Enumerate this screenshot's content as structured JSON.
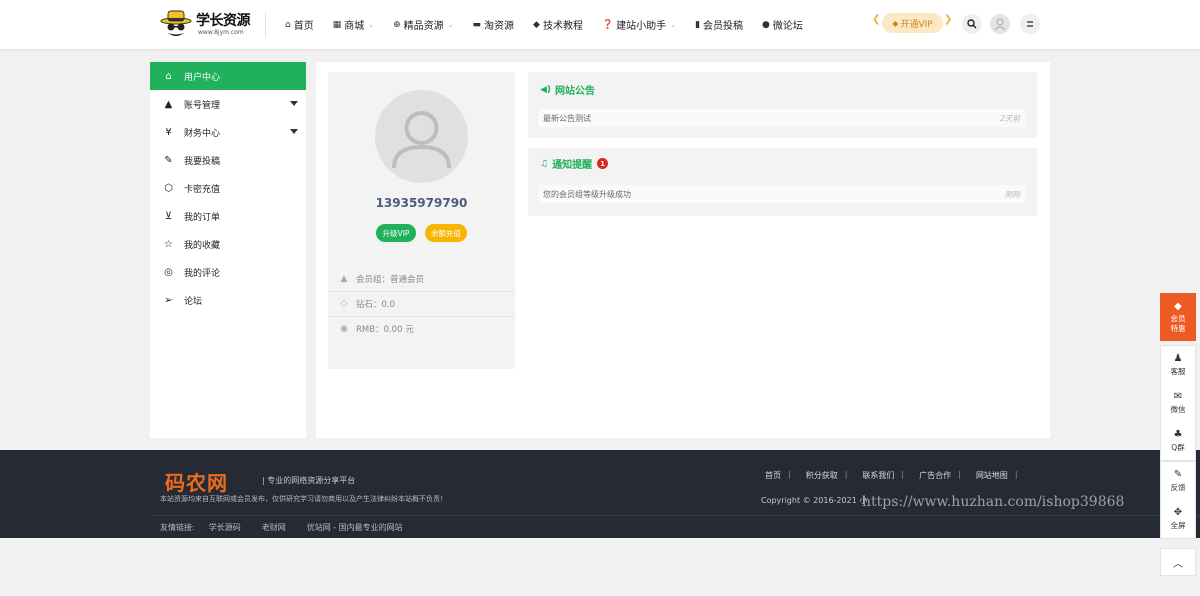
{
  "header": {
    "logo_text": "学长资源",
    "logo_sub": "www.8jym.com",
    "nav": [
      {
        "icon": "home-icon",
        "glyph": "⌂",
        "label": "首页",
        "caret": false
      },
      {
        "icon": "shop-icon",
        "glyph": "▦",
        "label": "商城",
        "caret": true
      },
      {
        "icon": "globe-icon",
        "glyph": "⊕",
        "label": "精品资源",
        "caret": true
      },
      {
        "icon": "briefcase-icon",
        "glyph": "▬",
        "label": "淘资源",
        "caret": false
      },
      {
        "icon": "graduation-icon",
        "glyph": "◆",
        "label": "技术教程",
        "caret": false
      },
      {
        "icon": "question-icon",
        "glyph": "❓",
        "label": "建站小助手",
        "caret": true
      },
      {
        "icon": "book-icon",
        "glyph": "▮",
        "label": "会员投稿",
        "caret": false
      },
      {
        "icon": "chat-icon",
        "glyph": "●",
        "label": "微论坛",
        "caret": false
      }
    ],
    "vip_label": "开通VIP"
  },
  "sidebar": {
    "items": [
      {
        "icon": "home-icon",
        "glyph": "⌂",
        "label": "用户中心",
        "active": true,
        "caret": false
      },
      {
        "icon": "user-icon",
        "glyph": "▲",
        "label": "账号管理",
        "active": false,
        "caret": true
      },
      {
        "icon": "yen-icon",
        "glyph": "¥",
        "label": "财务中心",
        "active": false,
        "caret": true
      },
      {
        "icon": "edit-icon",
        "glyph": "✎",
        "label": "我要投稿",
        "active": false,
        "caret": false
      },
      {
        "icon": "cube-icon",
        "glyph": "⬡",
        "label": "卡密充值",
        "active": false,
        "caret": false
      },
      {
        "icon": "cart-icon",
        "glyph": "⊻",
        "label": "我的订单",
        "active": false,
        "caret": false
      },
      {
        "icon": "star-icon",
        "glyph": "☆",
        "label": "我的收藏",
        "active": false,
        "caret": false
      },
      {
        "icon": "comment-icon",
        "glyph": "◎",
        "label": "我的评论",
        "active": false,
        "caret": false
      },
      {
        "icon": "send-icon",
        "glyph": "➢",
        "label": "论坛",
        "active": false,
        "caret": false
      }
    ]
  },
  "profile": {
    "username": "13935979790",
    "upgrade_label": "升级VIP",
    "recharge_label": "余额充值",
    "rows": [
      {
        "icon": "user-icon",
        "glyph": "▲",
        "text": "会员组：普通会员"
      },
      {
        "icon": "diamond-icon",
        "glyph": "◇",
        "text": "钻石：0.0"
      },
      {
        "icon": "coin-icon",
        "glyph": "◉",
        "text": "RMB：0.00 元"
      }
    ]
  },
  "announcement": {
    "title": "网站公告",
    "item_text": "最新公告测试",
    "item_time": "2天前"
  },
  "notification": {
    "title": "通知提醒",
    "badge": "1",
    "item_text": "您的会员组等级升级成功",
    "item_time": "刚刚"
  },
  "footer": {
    "logo": "码农网",
    "slogan": "专业的网络资源分享平台",
    "desc": "本站资源均来自互联网或会员发布，仅供研究学习请勿商用以及产生法律纠纷本站概不负责！",
    "links": [
      "首页",
      "积分获取",
      "联系我们",
      "广告合作",
      "网站地图"
    ],
    "copyright": "Copyright © 2016-2021 小",
    "friend_label": "友情链接:",
    "friends": [
      "学长源码",
      "老财网",
      "优站网 - 国内最专业的网站"
    ],
    "watermark": "https://www.huzhan.com/ishop39868"
  },
  "float_bar": {
    "vip_line1": "会员",
    "vip_line2": "特惠",
    "group1": [
      {
        "icon": "qq-icon",
        "glyph": "♟",
        "label": "客服"
      },
      {
        "icon": "wechat-icon",
        "glyph": "✉",
        "label": "微信"
      },
      {
        "icon": "group-icon",
        "glyph": "♣",
        "label": "Q群"
      }
    ],
    "group2": [
      {
        "icon": "feedback-icon",
        "glyph": "✎",
        "label": "反馈"
      },
      {
        "icon": "fullscreen-icon",
        "glyph": "✥",
        "label": "全屏"
      }
    ],
    "top_glyph": "︿"
  },
  "colors": {
    "accent": "#21b05b",
    "footer_bg": "#252a35",
    "footer_logo": "#ee6a1f",
    "vip_float": "#ee5a24",
    "badge": "#e0261c",
    "yellow": "#f7b500"
  }
}
